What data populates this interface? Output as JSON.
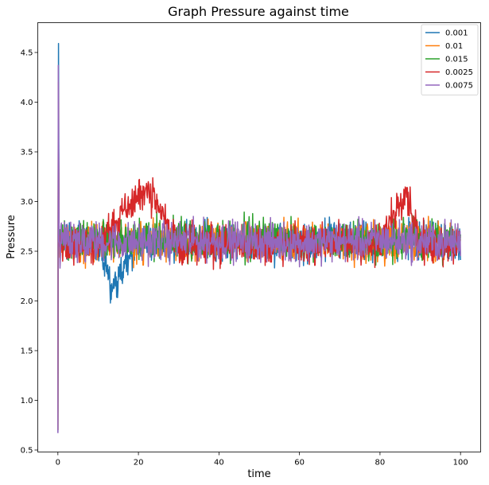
{
  "chart_data": {
    "type": "line",
    "title": "Graph Pressure against time",
    "xlabel": "time",
    "ylabel": "Pressure",
    "xlim": [
      -5,
      105
    ],
    "ylim": [
      0.48,
      4.8
    ],
    "xticks": [
      0,
      20,
      40,
      60,
      80,
      100
    ],
    "yticks": [
      0.5,
      1.0,
      1.5,
      2.0,
      2.5,
      3.0,
      3.5,
      4.0,
      4.5
    ],
    "xtick_labels": [
      "0",
      "20",
      "40",
      "60",
      "80",
      "100"
    ],
    "ytick_labels": [
      "0.5",
      "1.0",
      "1.5",
      "2.0",
      "2.5",
      "3.0",
      "3.5",
      "4.0",
      "4.5"
    ],
    "grid": false,
    "legend_position": "top-right",
    "series": [
      {
        "name": "0.001",
        "color": "#1f77b4",
        "x": [
          0,
          0.15,
          0.3,
          5,
          10,
          13.6,
          20,
          25,
          30,
          40,
          50,
          60,
          70,
          80,
          90,
          100
        ],
        "y": [
          0.68,
          4.59,
          2.6,
          2.63,
          2.55,
          2.12,
          2.61,
          2.58,
          2.62,
          2.57,
          2.6,
          2.59,
          2.61,
          2.58,
          2.62,
          2.6
        ]
      },
      {
        "name": "0.01",
        "color": "#ff7f0e",
        "x": [
          0,
          0.1,
          0.3,
          10,
          20,
          30,
          40,
          50,
          60,
          70,
          80,
          90,
          100
        ],
        "y": [
          0.7,
          4.0,
          2.6,
          2.61,
          2.6,
          2.59,
          2.62,
          2.6,
          2.61,
          2.59,
          2.6,
          2.61,
          2.6
        ]
      },
      {
        "name": "0.015",
        "color": "#2ca02c",
        "x": [
          0,
          0.1,
          0.3,
          10,
          20,
          30,
          40,
          50,
          60,
          70,
          80,
          90,
          100
        ],
        "y": [
          0.7,
          3.8,
          2.62,
          2.62,
          2.61,
          2.62,
          2.6,
          2.63,
          2.61,
          2.62,
          2.6,
          2.62,
          2.61
        ]
      },
      {
        "name": "0.0025",
        "color": "#d62728",
        "x": [
          0,
          0.1,
          0.3,
          10,
          21.8,
          30,
          40,
          50,
          60,
          70,
          80,
          86.3,
          90,
          100
        ],
        "y": [
          0.7,
          4.2,
          2.55,
          2.58,
          3.14,
          2.57,
          2.58,
          2.56,
          2.57,
          2.58,
          2.56,
          3.15,
          2.57,
          2.58
        ]
      },
      {
        "name": "0.0075",
        "color": "#9467bd",
        "x": [
          0,
          0.1,
          0.3,
          10,
          20,
          30,
          40,
          50,
          60,
          70,
          80,
          90,
          100
        ],
        "y": [
          0.67,
          4.37,
          2.6,
          2.6,
          2.59,
          2.6,
          2.61,
          2.6,
          2.59,
          2.6,
          2.61,
          2.6,
          2.6
        ]
      }
    ]
  }
}
